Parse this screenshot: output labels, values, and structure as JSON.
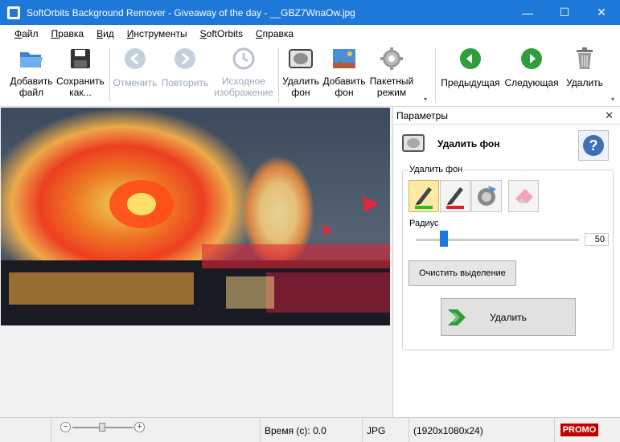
{
  "window": {
    "title": "SoftOrbits Background Remover - Giveaway of the day - __GBZ7WnaOw.jpg",
    "minimize": "—",
    "maximize": "☐",
    "close": "✕"
  },
  "menu": [
    "Файл",
    "Правка",
    "Вид",
    "Инструменты",
    "SoftOrbits",
    "Справка"
  ],
  "toolbar": {
    "add_file": [
      "Добавить",
      "файл"
    ],
    "save_as": [
      "Сохранить",
      "как..."
    ],
    "undo": "Отменить",
    "redo": "Повторить",
    "original_image": [
      "Исходное",
      "изображение"
    ],
    "remove_bg": [
      "Удалить",
      "фон"
    ],
    "add_bg": [
      "Добавить",
      "фон"
    ],
    "batch": [
      "Пакетный",
      "режим"
    ],
    "previous": "Предыдущая",
    "next": "Следующая",
    "delete": "Удалить"
  },
  "panel": {
    "header": "Параметры",
    "close": "✕",
    "title": "Удалить фон",
    "help": "?",
    "group_label": "Удалить фон",
    "radius_label": "Радиус",
    "radius_value": "50",
    "radius_fraction": 0.17,
    "clear_selection": "Очистить выделение",
    "remove_button": "Удалить"
  },
  "status": {
    "zoom_minus": "−",
    "zoom_plus": "+",
    "time": "Время (с): 0.0",
    "format": "JPG",
    "dimensions": "(1920x1080x24)",
    "promo": "PROMO"
  },
  "colors": {
    "titlebar": "#1e78d8",
    "nav_green": "#2f9e3a",
    "promo_red": "#c00000"
  }
}
